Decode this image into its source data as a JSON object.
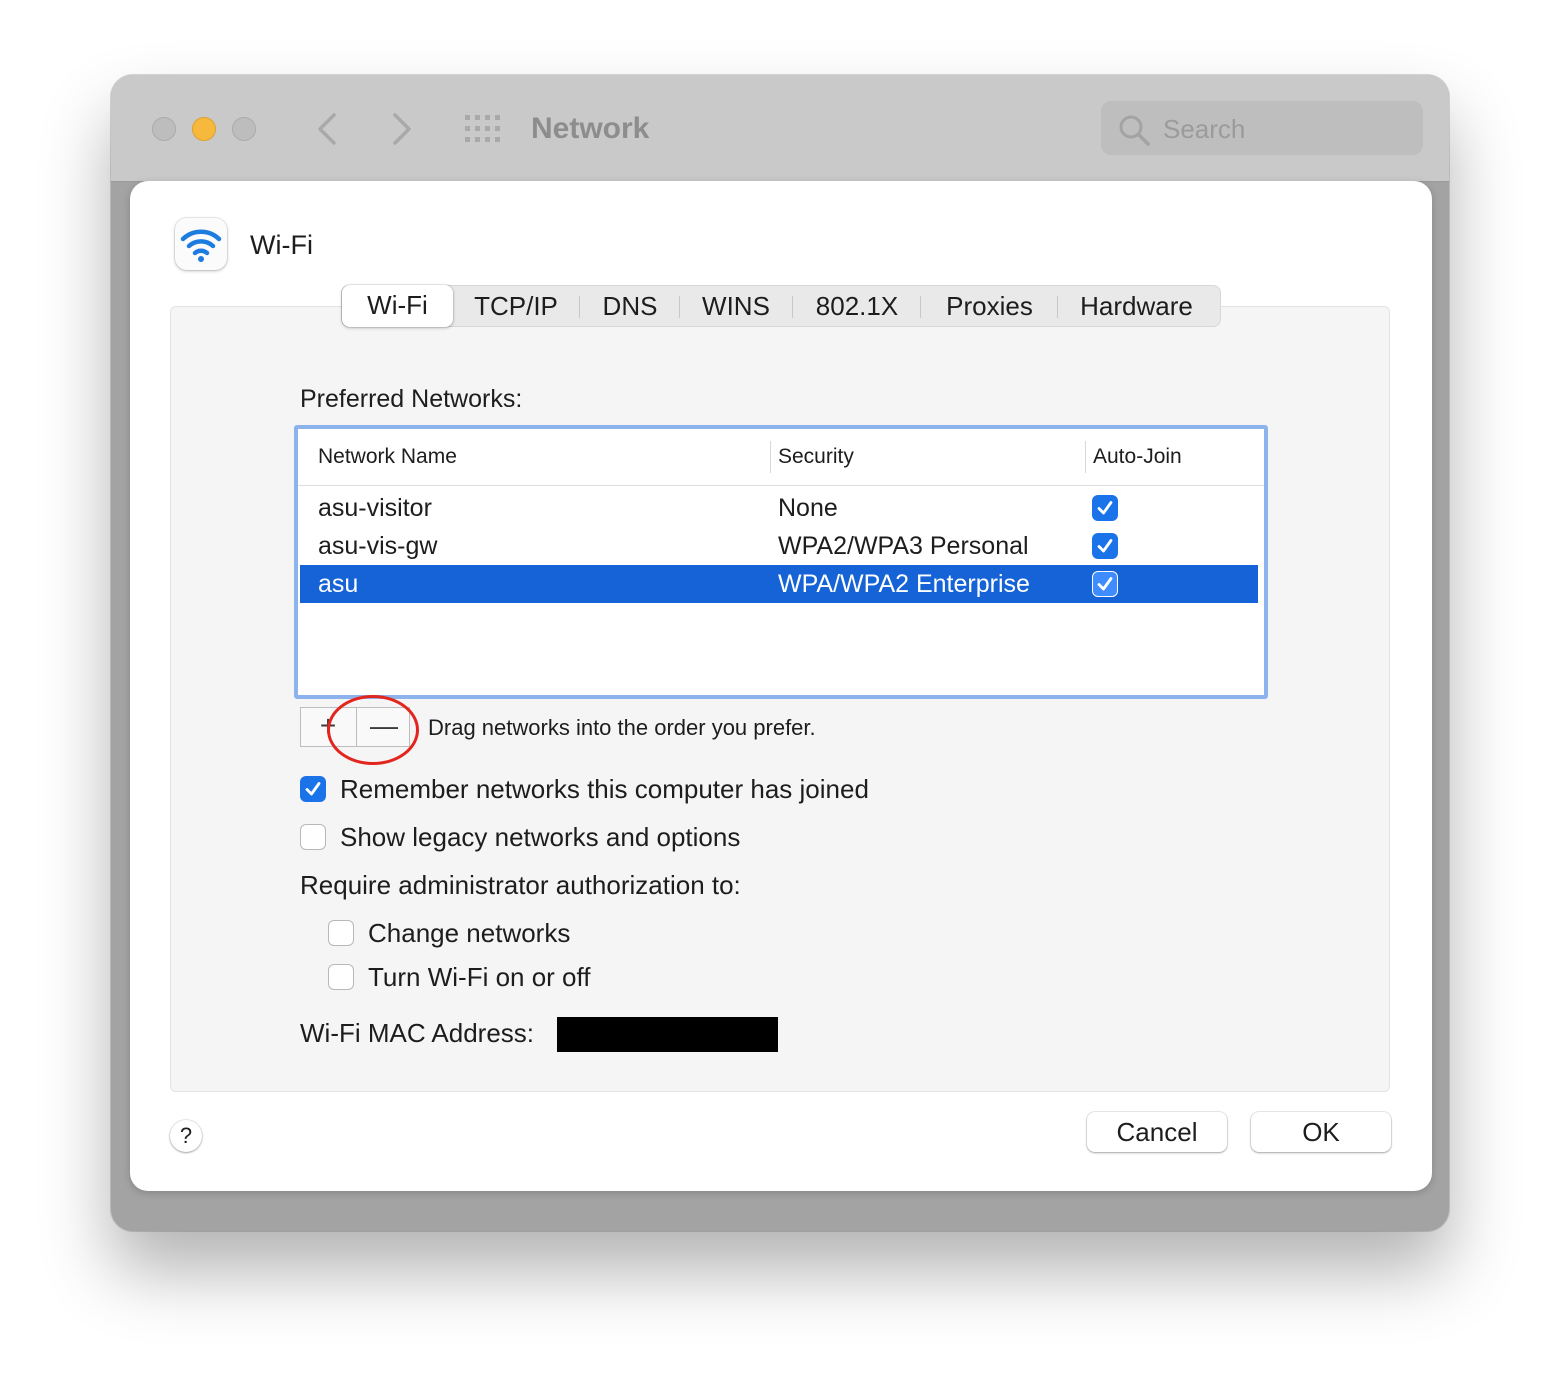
{
  "window": {
    "title": "Network",
    "search": {
      "placeholder": "Search"
    }
  },
  "sheet": {
    "title": "Wi-Fi",
    "tabs": [
      {
        "label": "Wi-Fi",
        "active": true
      },
      {
        "label": "TCP/IP"
      },
      {
        "label": "DNS"
      },
      {
        "label": "WINS"
      },
      {
        "label": "802.1X"
      },
      {
        "label": "Proxies"
      },
      {
        "label": "Hardware"
      }
    ],
    "preferred_label": "Preferred Networks:",
    "table": {
      "columns": [
        "Network Name",
        "Security",
        "Auto-Join"
      ],
      "rows": [
        {
          "name": "asu-visitor",
          "security": "None",
          "auto_join": true,
          "selected": false
        },
        {
          "name": "asu-vis-gw",
          "security": "WPA2/WPA3 Personal",
          "auto_join": true,
          "selected": false
        },
        {
          "name": "asu",
          "security": "WPA/WPA2 Enterprise",
          "auto_join": true,
          "selected": true
        }
      ]
    },
    "add_label": "+",
    "remove_label": "—",
    "drag_hint": "Drag networks into the order you prefer.",
    "options": {
      "remember": {
        "label": "Remember networks this computer has joined",
        "checked": true
      },
      "legacy": {
        "label": "Show legacy networks and options",
        "checked": false
      }
    },
    "require_label": "Require administrator authorization to:",
    "admin": {
      "change_networks": {
        "label": "Change networks",
        "checked": false
      },
      "turn_wifi": {
        "label": "Turn Wi-Fi on or off",
        "checked": false
      }
    },
    "mac_label": "Wi-Fi MAC Address:",
    "help_label": "?",
    "cancel_label": "Cancel",
    "ok_label": "OK"
  },
  "colors": {
    "selection": "#1563d6",
    "checkbox_on": "#1a73e8",
    "focus_ring": "#8cb3ec",
    "annotation": "#e3261d"
  },
  "icons": [
    "back-chevron-icon",
    "forward-chevron-icon",
    "show-all-grid-icon",
    "search-icon",
    "wifi-icon",
    "checkmark-icon"
  ]
}
